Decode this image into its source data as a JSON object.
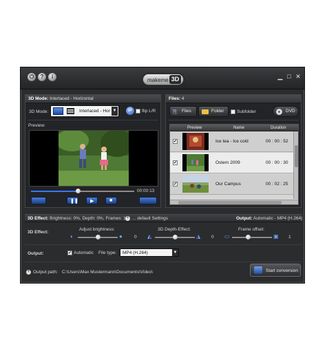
{
  "app": {
    "logo_text": "makeme",
    "logo_badge": "3D",
    "title_icons": [
      "power-icon",
      "help-icon",
      "info-icon"
    ],
    "window_controls": [
      "minimize-icon",
      "maximize-icon",
      "close-icon"
    ]
  },
  "mode_panel": {
    "header_label": "3D Mode:",
    "header_value": "Interlaced - Horizontal",
    "mode_label": "3D Mode:",
    "mode_select": "Interlaced - Hor",
    "flip_label": "flip L/R",
    "preview_label": "Preview:",
    "time": "00:00:13",
    "progress": 0.45
  },
  "files_panel": {
    "header_label": "Files:",
    "header_count": "4",
    "files_button": "Files",
    "folder_button": "Folder",
    "subfolder_label": "Subfolder",
    "dvd_button": "DVD",
    "columns": [
      "Preview",
      "Name",
      "Duration"
    ],
    "rows": [
      {
        "name": "Ice tea - Ice cold",
        "duration": "00 : 00 : 52",
        "checked": true
      },
      {
        "name": "Ostern 2009",
        "duration": "00 : 00 : 30",
        "checked": true
      },
      {
        "name": "Our Campus",
        "duration": "00 : 02 : 25",
        "checked": true
      }
    ]
  },
  "effect_bar": {
    "label": "3D Effect:",
    "value": "Brightness: 0%, Depth: 0%, Frames: 1",
    "default_settings": "... default Settings",
    "output_label": "Output:",
    "output_value": "Automatic - MP4 (H.264)"
  },
  "effect_controls": {
    "label": "3D Effect:",
    "brightness_label": "Adjust brightness:",
    "brightness_value": "0",
    "depth_label": "3D Depth-Effect:",
    "depth_value": "0",
    "frame_label": "Frame offset:",
    "frame_value": "1",
    "brightness_level": 0.5,
    "depth_level": 0.5,
    "frame_level": 0.4
  },
  "output": {
    "label": "Output:",
    "automatic_label": "Automatic",
    "file_type_label": "File type:",
    "file_type_value": "MP4 (H.264)",
    "path_label": "Output path:",
    "path_value": "C:\\Users\\Max Mustermann\\Documents\\Video\\",
    "start_button": "Start conversion"
  },
  "colors": {
    "accent_blue": "#2a5cc0",
    "panel_bg": "#232427",
    "selected_row": "#e6e6e6"
  }
}
